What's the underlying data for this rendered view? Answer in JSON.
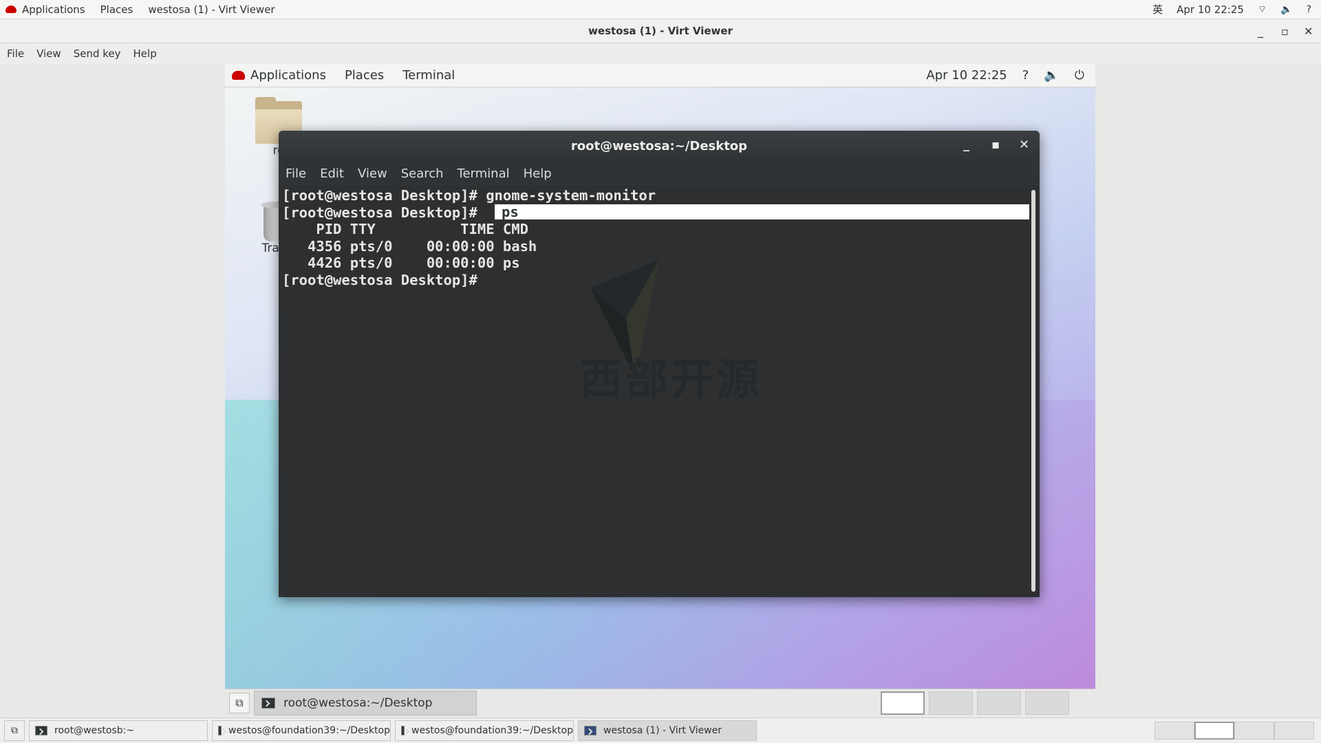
{
  "host": {
    "menu": {
      "applications": "Applications",
      "places": "Places",
      "window": "westosa (1) - Virt Viewer"
    },
    "status": {
      "input_method": "英",
      "datetime": "Apr 10  22:25"
    },
    "taskbar": [
      {
        "label": "root@westosb:~"
      },
      {
        "label": "westos@foundation39:~/Desktop"
      },
      {
        "label": "westos@foundation39:~/Desktop"
      },
      {
        "label": "westosa (1) - Virt Viewer"
      }
    ]
  },
  "viewer": {
    "title": "westosa (1) - Virt Viewer",
    "menu": [
      "File",
      "View",
      "Send key",
      "Help"
    ]
  },
  "guest": {
    "topbar": {
      "applications": "Applications",
      "places": "Places",
      "terminal": "Terminal",
      "datetime": "Apr 10  22:25"
    },
    "desktop": {
      "home_label": "ro",
      "trash_label": "Trash"
    },
    "taskbar": {
      "task_label": "root@westosa:~/Desktop"
    }
  },
  "terminal": {
    "title": "root@westosa:~/Desktop",
    "menu": [
      "File",
      "Edit",
      "View",
      "Search",
      "Terminal",
      "Help"
    ],
    "lines": [
      "[root@westosa Desktop]# gnome-system-monitor",
      "[root@westosa Desktop]#",
      "    PID TTY          TIME CMD",
      "   4356 pts/0    00:00:00 bash",
      "   4426 pts/0    00:00:00 ps",
      "[root@westosa Desktop]#"
    ],
    "current_command": "ps",
    "watermark_text": "西部开源"
  },
  "colors": {
    "terminal_bg": "#2d2f31",
    "terminal_fg": "#e6e6e4",
    "accent_red": "#cc0000"
  }
}
